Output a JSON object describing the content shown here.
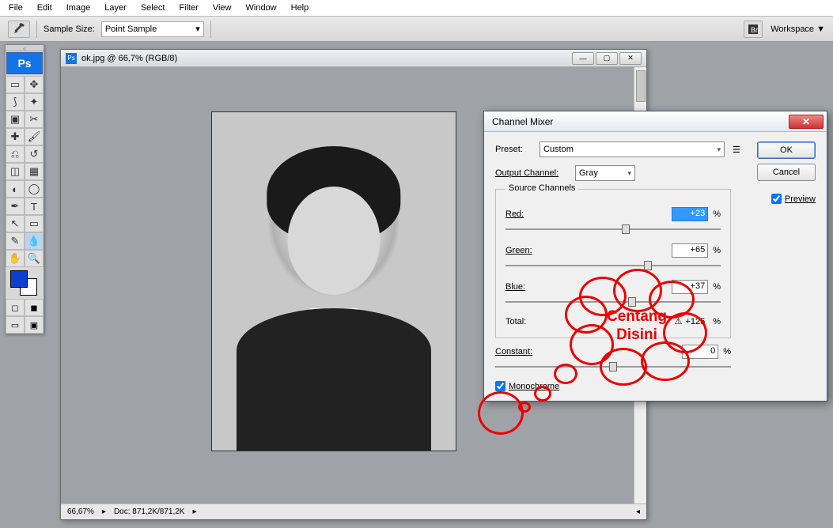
{
  "menu": {
    "items": [
      "File",
      "Edit",
      "Image",
      "Layer",
      "Select",
      "Filter",
      "View",
      "Window",
      "Help"
    ]
  },
  "options": {
    "sample_size_label": "Sample Size:",
    "sample_size_value": "Point Sample",
    "workspace_label": "Workspace ▼"
  },
  "toolbox": {
    "ps": "Ps"
  },
  "document": {
    "title": "ok.jpg @ 66,7% (RGB/8)",
    "zoom": "66,67%",
    "doc_info": "Doc: 871,2K/871,2K"
  },
  "dialog": {
    "title": "Channel Mixer",
    "preset_label": "Preset:",
    "preset_value": "Custom",
    "output_label": "Output Channel:",
    "output_value": "Gray",
    "ok": "OK",
    "cancel": "Cancel",
    "preview": "Preview",
    "source_legend": "Source Channels",
    "red_label": "Red:",
    "red_value": "+23",
    "green_label": "Green:",
    "green_value": "+65",
    "blue_label": "Blue:",
    "blue_value": "+37",
    "total_label": "Total:",
    "total_value": "+125",
    "constant_label": "Constant:",
    "constant_value": "0",
    "percent": "%",
    "mono_label": "Monochrome"
  },
  "annotation": {
    "text": "Centang\nDisini"
  }
}
